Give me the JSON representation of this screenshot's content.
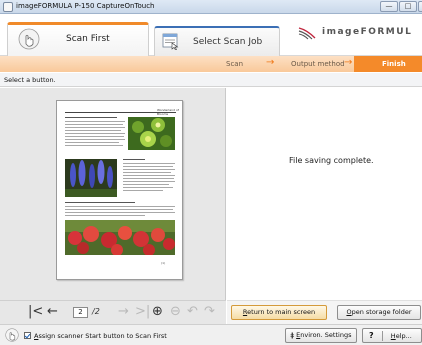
{
  "window": {
    "title": "imageFORMULA P-150 CaptureOnTouch",
    "minimize_glyph": "—",
    "maximize_glyph": "□",
    "close_glyph": "✕"
  },
  "tabs": [
    {
      "label": "Scan First",
      "icon": "hand-touch-icon",
      "active": true
    },
    {
      "label": "Select Scan Job",
      "icon": "scan-job-list-icon",
      "active": false
    }
  ],
  "brand": {
    "text": "imageFORMUL",
    "icon": "canon-logo-icon"
  },
  "steps": {
    "scan": "Scan",
    "output": "Output method",
    "finish": "Finish",
    "arrow": "→"
  },
  "instruction": "Select a button.",
  "preview": {
    "page_header": "Wonderland of Blooms",
    "page_number": "(1)"
  },
  "nav": {
    "first": "|<",
    "prev": "←",
    "current_page": "2",
    "total_pages": "/2",
    "next": "→",
    "last": ">|",
    "zoom_in": "⊕",
    "zoom_out": "⊖",
    "rotate_left": "↶",
    "rotate_right": "↷"
  },
  "status_message": "File saving complete.",
  "buttons": {
    "return_main": {
      "first": "R",
      "rest": "eturn to main screen"
    },
    "open_folder": {
      "first": "O",
      "rest": "pen storage folder"
    },
    "environ": {
      "first": "E",
      "rest": "nviron. Settings",
      "icon": "settings-icon"
    },
    "help_q": "?",
    "help": {
      "first": "H",
      "rest": "elp..."
    }
  },
  "assign_checkbox": {
    "checked": true,
    "first": "A",
    "rest": "ssign scanner Start button to Scan First"
  },
  "colors": {
    "accent_orange": "#f48a2a",
    "accent_blue": "#3b6fb5",
    "steps_bg": "#f9c99a"
  }
}
